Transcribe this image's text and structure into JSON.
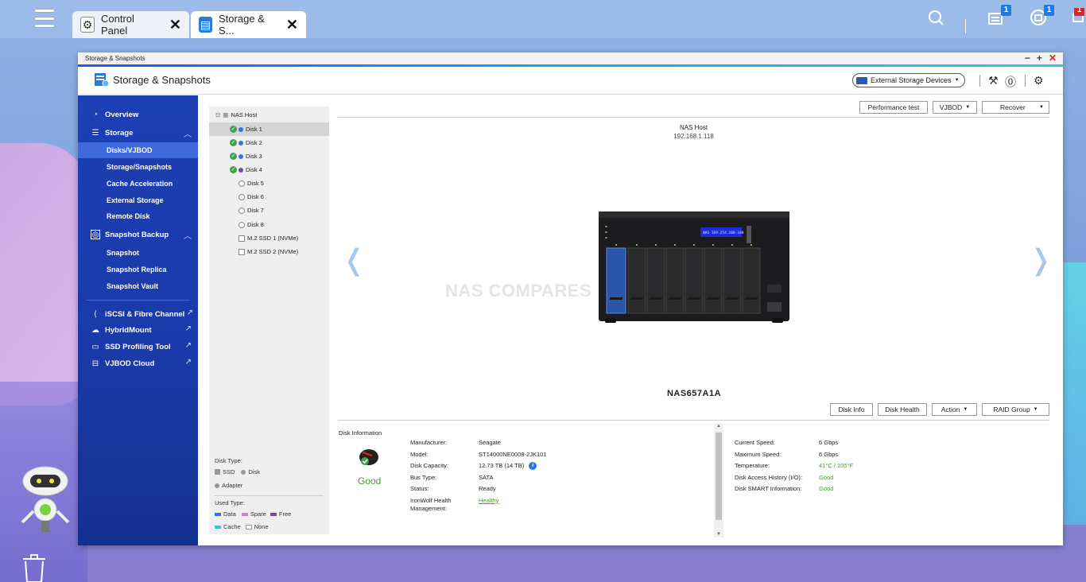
{
  "taskbar": {
    "tabs": [
      {
        "label": "Control Panel"
      },
      {
        "label": "Storage & S..."
      }
    ],
    "badges": {
      "notifications": "1",
      "tasks": "1",
      "alerts": "1"
    }
  },
  "window": {
    "title": "Storage & Snapshots",
    "app_title": "Storage & Snapshots",
    "external_devices_label": "External Storage Devices"
  },
  "sidebar": {
    "overview": "Overview",
    "storage": "Storage",
    "storage_items": [
      "Disks/VJBOD",
      "Storage/Snapshots",
      "Cache Acceleration",
      "External Storage",
      "Remote Disk"
    ],
    "snapshot_backup": "Snapshot Backup",
    "snapshot_items": [
      "Snapshot",
      "Snapshot Replica",
      "Snapshot Vault"
    ],
    "tools": [
      "iSCSI & Fibre Channel",
      "HybridMount",
      "SSD Profiling Tool",
      "VJBOD Cloud"
    ]
  },
  "tree": {
    "root": "NAS Host",
    "disks": [
      "Disk 1",
      "Disk 2",
      "Disk 3",
      "Disk 4",
      "Disk 5",
      "Disk 6",
      "Disk 7",
      "Disk 8"
    ],
    "ssds": [
      "M.2 SSD 1 (NVMe)",
      "M.2 SSD 2 (NVMe)"
    ],
    "legend": {
      "disk_type_label": "Disk Type:",
      "ssd": "SSD",
      "disk": "Disk",
      "adapter": "Adapter",
      "used_type_label": "Used Type:",
      "data": "Data",
      "spare": "Spare",
      "free": "Free",
      "cache": "Cache",
      "none": "None"
    }
  },
  "toolbar": {
    "performance_test": "Performance test",
    "vjbod": "VJBOD",
    "recover": "Recover"
  },
  "device": {
    "host_label": "NAS Host",
    "ip": "192.168.1.118",
    "lcd_text": "NAS 169.254.100.100",
    "watermark": "NAS COMPARES",
    "model": "NAS657A1A"
  },
  "disk_actions": {
    "disk_info": "Disk Info",
    "disk_health": "Disk Health",
    "action": "Action",
    "raid_group": "RAID Group"
  },
  "disk_information": {
    "section_label": "Disk Information",
    "status_summary": "Good",
    "left": [
      {
        "label": "Manufacturer:",
        "value": "Seagate"
      },
      {
        "label": "Model:",
        "value": "ST14000NE0008-2JK101"
      },
      {
        "label": "Disk Capacity:",
        "value": "12.73 TB (14 TB)"
      },
      {
        "label": "Bus Type:",
        "value": "SATA"
      },
      {
        "label": "Status:",
        "value": "Ready"
      },
      {
        "label": "IronWolf Health Management:",
        "value": "Healthy"
      }
    ],
    "right": [
      {
        "label": "Current Speed:",
        "value": "6 Gbps"
      },
      {
        "label": "Maximum Speed:",
        "value": "6 Gbps"
      },
      {
        "label": "Temperature:",
        "value": "41°C / 105°F"
      },
      {
        "label": "Disk Access History (I/O):",
        "value": "Good"
      },
      {
        "label": "Disk SMART Information:",
        "value": "Good"
      }
    ]
  },
  "colors": {
    "sidebar": "#1d3fb5",
    "accent": "#16a9e8",
    "good": "#4c9a2a",
    "disk_dot": "#3a6ee8",
    "disk4_dot": "#7a4a9a"
  }
}
